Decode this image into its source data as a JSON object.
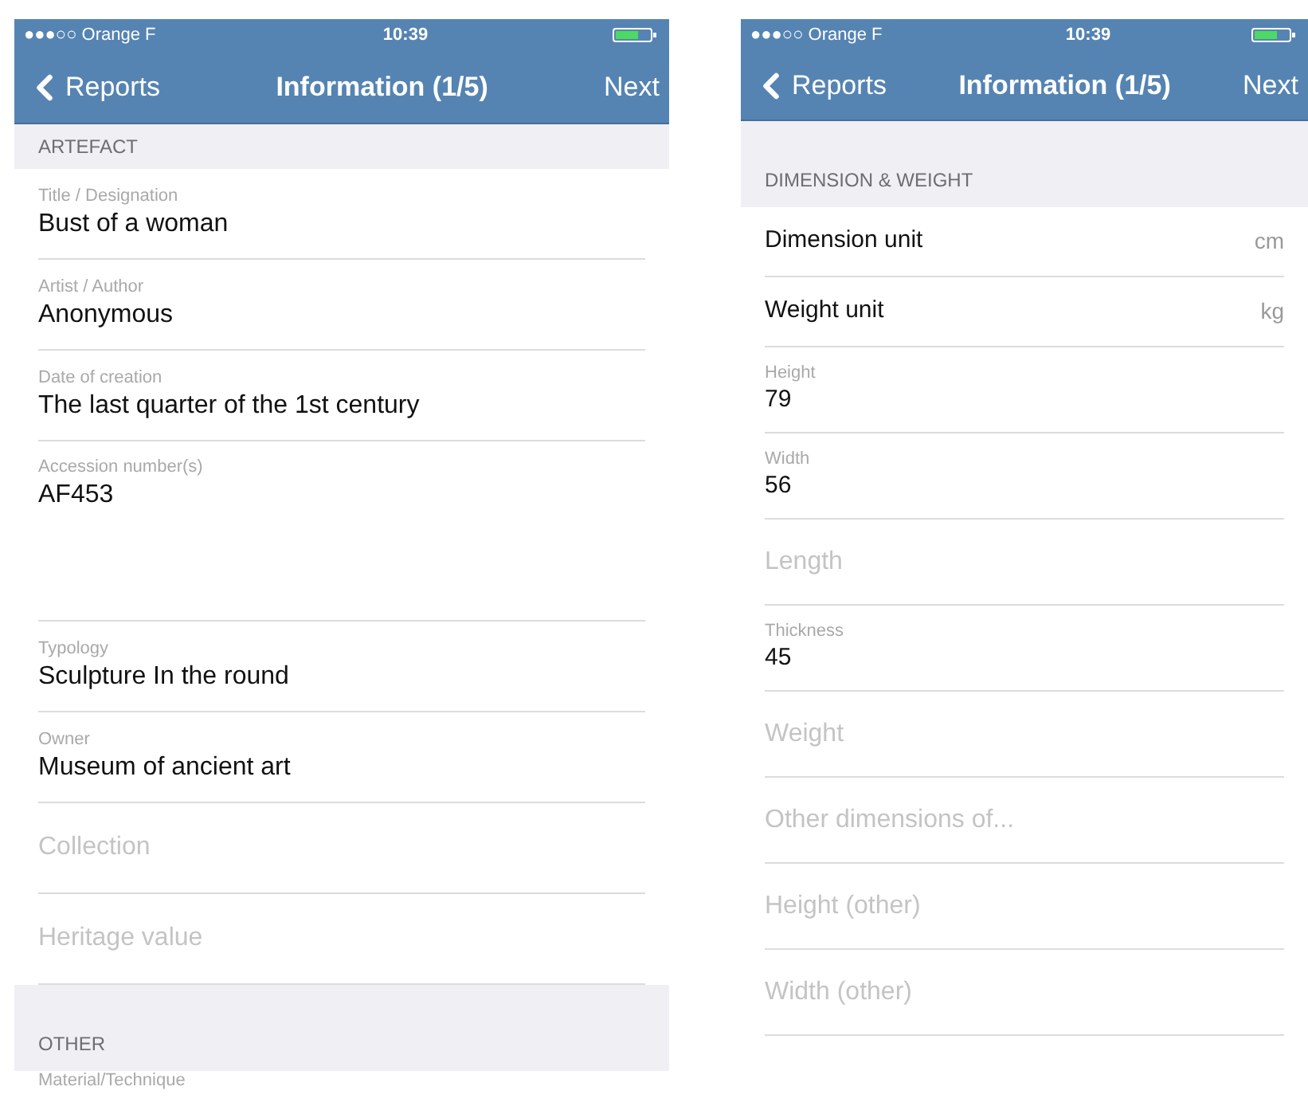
{
  "screens": [
    {
      "status_bar": {
        "carrier": "●●●○○ Orange F",
        "time": "10:39"
      },
      "nav": {
        "back": "Reports",
        "title": "Information (1/5)",
        "next": "Next"
      },
      "sections": [
        {
          "title": "ARTEFACT",
          "kind": "plain",
          "rows": [
            {
              "kind": "field",
              "label": "Title / Designation",
              "value": "Bust of a woman"
            },
            {
              "kind": "field",
              "label": "Artist / Author",
              "value": "Anonymous"
            },
            {
              "kind": "field",
              "label": "Date of creation",
              "value": "The last quarter of the 1st century"
            },
            {
              "kind": "tall",
              "label": "Accession number(s)",
              "value": "AF453"
            },
            {
              "kind": "field",
              "label": "Typology",
              "value": "Sculpture In the round"
            },
            {
              "kind": "field",
              "label": "Owner",
              "value": "Museum of ancient art"
            },
            {
              "kind": "empty",
              "placeholder": "Collection"
            },
            {
              "kind": "empty",
              "placeholder": "Heritage value"
            }
          ]
        },
        {
          "title": "OTHER",
          "kind": "spaced",
          "rows": [
            {
              "kind": "label",
              "label": "Material/Technique"
            }
          ]
        }
      ]
    },
    {
      "status_bar": {
        "carrier": "●●●○○ Orange F",
        "time": "10:39"
      },
      "nav": {
        "back": "Reports",
        "title": "Information (1/5)",
        "next": "Next"
      },
      "sections": [
        {
          "title": "DIMENSION & WEIGHT",
          "kind": "spaced",
          "rows": [
            {
              "kind": "picker",
              "label": "Dimension unit",
              "value": "cm"
            },
            {
              "kind": "picker",
              "label": "Weight unit",
              "value": "kg"
            },
            {
              "kind": "field",
              "label": "Height",
              "value": "79"
            },
            {
              "kind": "field",
              "label": "Width",
              "value": "56"
            },
            {
              "kind": "empty",
              "placeholder": "Length"
            },
            {
              "kind": "field",
              "label": "Thickness",
              "value": "45"
            },
            {
              "kind": "empty",
              "placeholder": "Weight"
            },
            {
              "kind": "empty",
              "placeholder": "Other dimensions of..."
            },
            {
              "kind": "empty",
              "placeholder": "Height (other)"
            },
            {
              "kind": "empty",
              "placeholder": "Width (other)"
            }
          ]
        }
      ]
    }
  ]
}
